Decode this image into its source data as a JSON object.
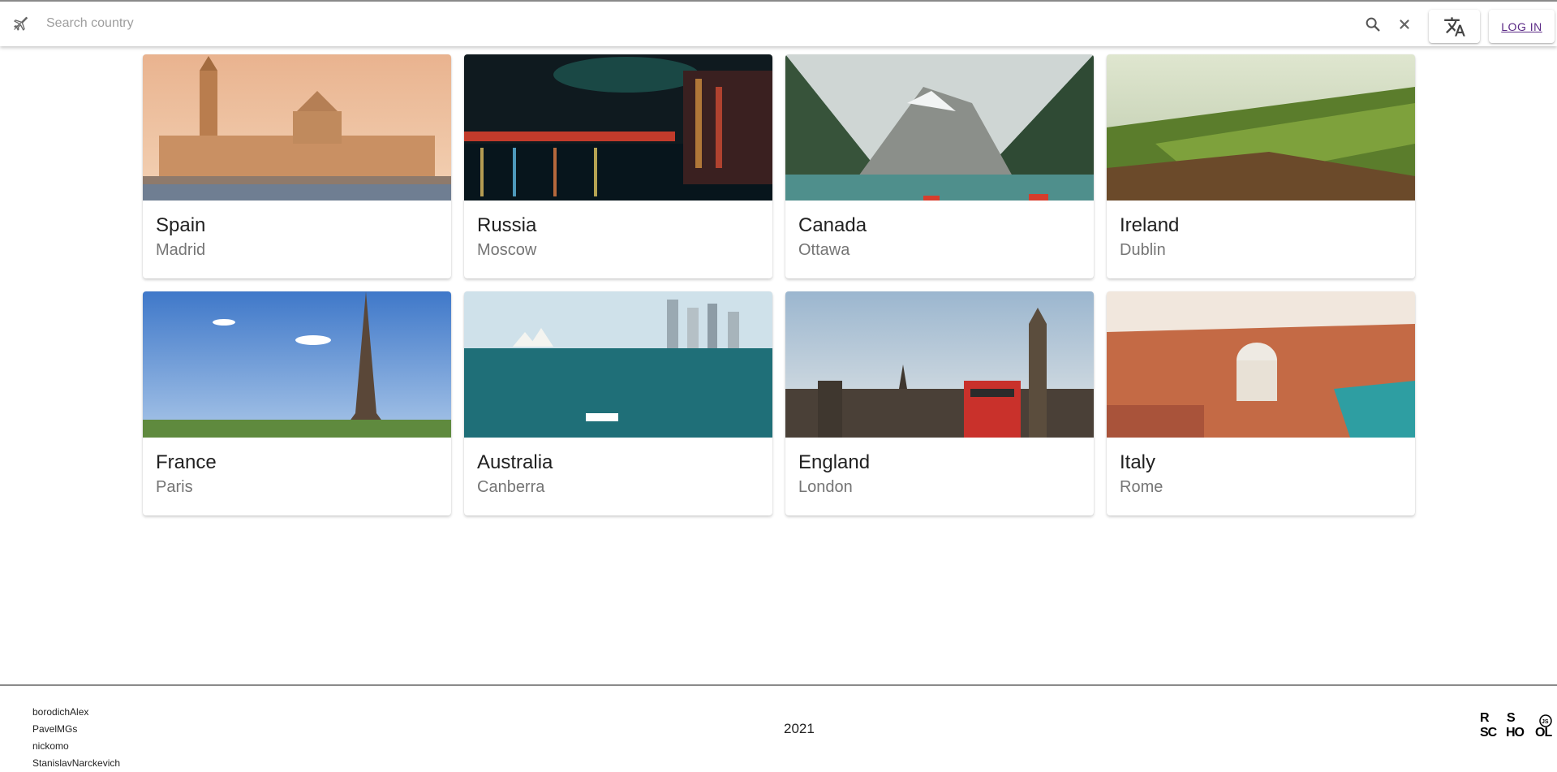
{
  "header": {
    "app_icon": "airplane-icon",
    "search_placeholder": "Search country",
    "search_icon": "search-icon",
    "clear_icon": "close-icon",
    "language_icon": "translate-icon",
    "login_label": "LOG IN"
  },
  "countries": [
    {
      "name": "Spain",
      "capital": "Madrid"
    },
    {
      "name": "Russia",
      "capital": "Moscow"
    },
    {
      "name": "Canada",
      "capital": "Ottawa"
    },
    {
      "name": "Ireland",
      "capital": "Dublin"
    },
    {
      "name": "France",
      "capital": "Paris"
    },
    {
      "name": "Australia",
      "capital": "Canberra"
    },
    {
      "name": "England",
      "capital": "London"
    },
    {
      "name": "Italy",
      "capital": "Rome"
    }
  ],
  "footer": {
    "authors": [
      "borodichAlex",
      "PavelMGs",
      "nickomo",
      "StanislavNarckevich"
    ],
    "year": "2021",
    "school_logo": "rs-school-js-logo",
    "school_logo_text": "RS SCHOOL JS"
  }
}
